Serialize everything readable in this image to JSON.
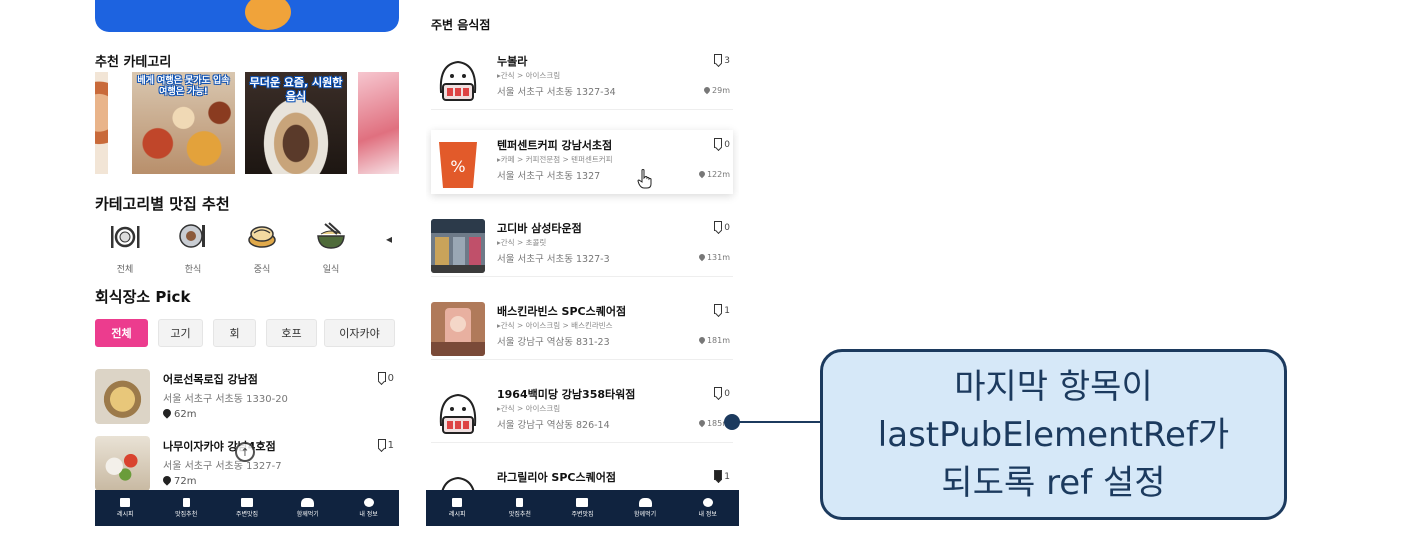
{
  "left": {
    "banner_text": "",
    "recommend_title": "추천 카테고리",
    "recommend_cards": [
      {
        "overlay": ""
      },
      {
        "overlay": "베게 여행은 못가도 입속 여행은 가능!"
      },
      {
        "overlay": "무더운 요즘, 시원한 음식"
      },
      {
        "overlay": ""
      }
    ],
    "category_title": "카테고리별 맛집 추천",
    "categories": [
      {
        "label": "전체",
        "icon": "cutlery-icon"
      },
      {
        "label": "한식",
        "icon": "korean-food-icon"
      },
      {
        "label": "중식",
        "icon": "dumpling-icon"
      },
      {
        "label": "일식",
        "icon": "noodle-bowl-icon"
      }
    ],
    "pick_title": "회식장소 Pick",
    "chips": [
      "전체",
      "고기",
      "회",
      "호프",
      "이자카야"
    ],
    "places": [
      {
        "name": "어로선목로집 강남점",
        "addr": "서울 서초구 서초동 1330-20",
        "dist": "62m",
        "bookmarks": "0"
      },
      {
        "name": "나무이자카야 강남4호점",
        "addr": "서울 서초구 서초동 1327-7",
        "dist": "72m",
        "bookmarks": "1"
      }
    ]
  },
  "right": {
    "title": "주변 음식점",
    "places": [
      {
        "name": "누볼라",
        "path": "▸간식 > 아이스크림",
        "addr": "서울 서초구 서초동 1327-34",
        "dist": "29m",
        "bookmarks": "3"
      },
      {
        "name": "텐퍼센트커피 강남서초점",
        "path": "▸카페 > 커피전문점 > 텐퍼센트커피",
        "addr": "서울 서초구 서초동 1327",
        "dist": "122m",
        "bookmarks": "0"
      },
      {
        "name": "고디바 삼성타운점",
        "path": "▸간식 > 초콜릿",
        "addr": "서울 서초구 서초동 1327-3",
        "dist": "131m",
        "bookmarks": "0"
      },
      {
        "name": "배스킨라빈스 SPC스퀘어점",
        "path": "▸간식 > 아이스크림 > 배스킨라빈스",
        "addr": "서울 강남구 역삼동 831-23",
        "dist": "181m",
        "bookmarks": "1"
      },
      {
        "name": "1964백미당 강남358타워점",
        "path": "▸간식 > 아이스크림",
        "addr": "서울 강남구 역삼동 826-14",
        "dist": "185m",
        "bookmarks": "0"
      },
      {
        "name": "라그릴리아 SPC스퀘어점",
        "path": "",
        "addr": "",
        "dist": "",
        "bookmarks": "1"
      }
    ]
  },
  "nav": [
    {
      "label": "레시피",
      "icon": "recipe-icon"
    },
    {
      "label": "맛집추천",
      "icon": "fork-knife-icon"
    },
    {
      "label": "주변맛집",
      "icon": "map-icon"
    },
    {
      "label": "함께먹기",
      "icon": "people-icon"
    },
    {
      "label": "내 정보",
      "icon": "user-icon"
    }
  ],
  "callout": {
    "line1": "마지막 항목이",
    "line2": "lastPubElementRef가",
    "line3": "되도록 ref 설정"
  },
  "colors": {
    "accent_pink": "#ec3c8e",
    "nav_bg": "#10233f",
    "callout_bg": "#d6e8f8",
    "callout_border": "#1c3a5e",
    "banner_blue": "#1d63e0"
  }
}
